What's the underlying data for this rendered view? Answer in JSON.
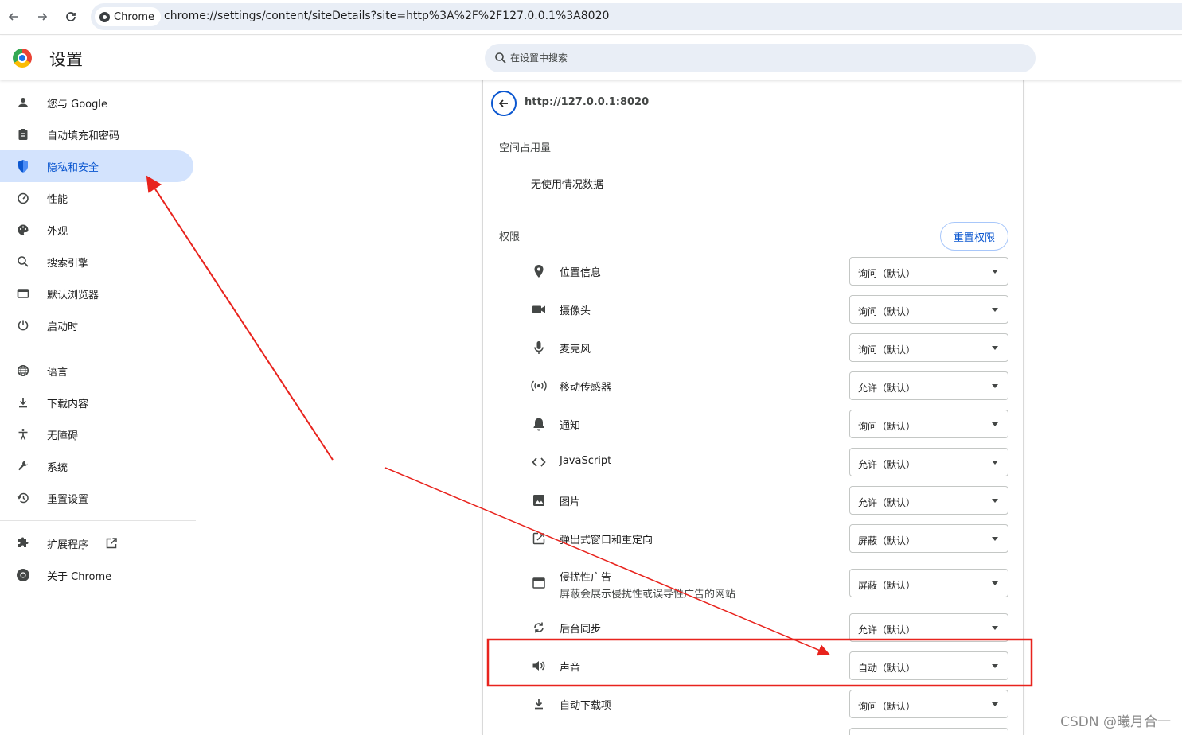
{
  "browser": {
    "chip_label": "Chrome",
    "url": "chrome://settings/content/siteDetails?site=http%3A%2F%2F127.0.0.1%3A8020"
  },
  "header": {
    "title": "设置",
    "search_placeholder": "在设置中搜索"
  },
  "sidebar": {
    "items": [
      {
        "label": "您与 Google",
        "icon": "person-icon"
      },
      {
        "label": "自动填充和密码",
        "icon": "clipboard-icon"
      },
      {
        "label": "隐私和安全",
        "icon": "shield-icon",
        "active": true
      },
      {
        "label": "性能",
        "icon": "speedometer-icon"
      },
      {
        "label": "外观",
        "icon": "palette-icon"
      },
      {
        "label": "搜索引擎",
        "icon": "search-icon"
      },
      {
        "label": "默认浏览器",
        "icon": "browser-window-icon"
      },
      {
        "label": "启动时",
        "icon": "power-icon"
      },
      {
        "label": "语言",
        "icon": "globe-icon"
      },
      {
        "label": "下载内容",
        "icon": "download-icon"
      },
      {
        "label": "无障碍",
        "icon": "accessibility-icon"
      },
      {
        "label": "系统",
        "icon": "wrench-icon"
      },
      {
        "label": "重置设置",
        "icon": "history-icon"
      },
      {
        "label": "扩展程序",
        "icon": "puzzle-icon"
      },
      {
        "label": "关于 Chrome",
        "icon": "chrome-icon"
      }
    ]
  },
  "site": {
    "origin": "http://127.0.0.1:8020",
    "usage_heading": "空间占用量",
    "usage_text": "无使用情况数据",
    "permissions_heading": "权限",
    "reset_label": "重置权限",
    "permissions": [
      {
        "name": "位置信息",
        "value": "询问（默认）",
        "icon": "location-pin-icon"
      },
      {
        "name": "摄像头",
        "value": "询问（默认）",
        "icon": "camera-icon"
      },
      {
        "name": "麦克风",
        "value": "询问（默认）",
        "icon": "microphone-icon"
      },
      {
        "name": "移动传感器",
        "value": "允许（默认）",
        "icon": "sensor-icon"
      },
      {
        "name": "通知",
        "value": "询问（默认）",
        "icon": "bell-icon"
      },
      {
        "name": "JavaScript",
        "value": "允许（默认）",
        "icon": "code-icon"
      },
      {
        "name": "图片",
        "value": "允许（默认）",
        "icon": "image-icon"
      },
      {
        "name": "弹出式窗口和重定向",
        "value": "屏蔽（默认）",
        "icon": "popup-icon"
      },
      {
        "name": "侵扰性广告",
        "sub": "屏蔽会展示侵扰性或误导性广告的网站",
        "value": "屏蔽（默认）",
        "icon": "ad-window-icon"
      },
      {
        "name": "后台同步",
        "value": "允许（默认）",
        "icon": "sync-icon"
      },
      {
        "name": "声音",
        "value": "自动（默认）",
        "icon": "speaker-icon"
      },
      {
        "name": "自动下载项",
        "value": "询问（默认）",
        "icon": "download-icon"
      }
    ]
  },
  "annotation": {
    "color": "#e8231d"
  },
  "watermark": "CSDN @曦月合一"
}
